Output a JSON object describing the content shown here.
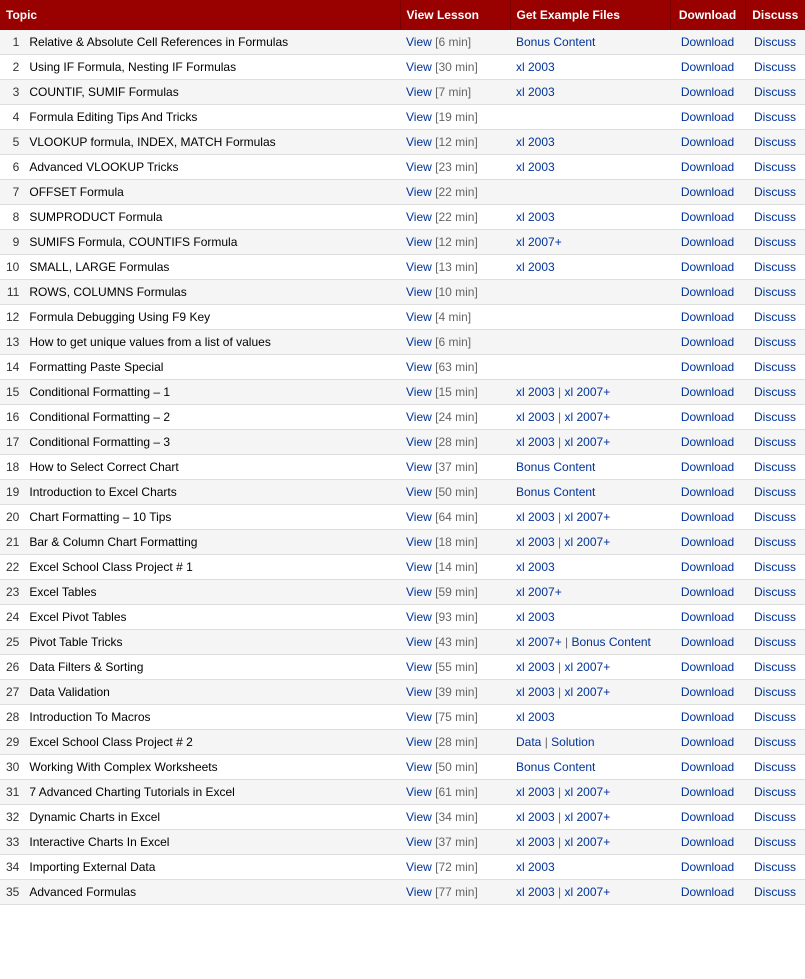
{
  "header": {
    "topic": "Topic",
    "view_lesson": "View Lesson",
    "example_files": "Get Example Files",
    "download": "Download",
    "discuss": "Discuss"
  },
  "rows": [
    {
      "num": 1,
      "topic": "Relative & Absolute Cell References in Formulas",
      "view": "View",
      "duration": "6 min",
      "example": [
        {
          "text": "Bonus Content",
          "href": "#"
        }
      ],
      "download": "Download",
      "discuss": "Discuss"
    },
    {
      "num": 2,
      "topic": "Using IF Formula, Nesting IF Formulas",
      "view": "View",
      "duration": "30 min",
      "example": [
        {
          "text": "xl 2003",
          "href": "#"
        }
      ],
      "download": "Download",
      "discuss": "Discuss"
    },
    {
      "num": 3,
      "topic": "COUNTIF, SUMIF Formulas",
      "view": "View",
      "duration": "7 min",
      "example": [
        {
          "text": "xl 2003",
          "href": "#"
        }
      ],
      "download": "Download",
      "discuss": "Discuss"
    },
    {
      "num": 4,
      "topic": "Formula Editing Tips And Tricks",
      "view": "View",
      "duration": "19 min",
      "example": [],
      "download": "Download",
      "discuss": "Discuss"
    },
    {
      "num": 5,
      "topic": "VLOOKUP formula, INDEX, MATCH Formulas",
      "view": "View",
      "duration": "12 min",
      "example": [
        {
          "text": "xl 2003",
          "href": "#"
        }
      ],
      "download": "Download",
      "discuss": "Discuss"
    },
    {
      "num": 6,
      "topic": "Advanced VLOOKUP Tricks",
      "view": "View",
      "duration": "23 min",
      "example": [
        {
          "text": "xl 2003",
          "href": "#"
        }
      ],
      "download": "Download",
      "discuss": "Discuss"
    },
    {
      "num": 7,
      "topic": "OFFSET Formula",
      "view": "View",
      "duration": "22 min",
      "example": [],
      "download": "Download",
      "discuss": "Discuss"
    },
    {
      "num": 8,
      "topic": "SUMPRODUCT Formula",
      "view": "View",
      "duration": "22 min",
      "example": [
        {
          "text": "xl 2003",
          "href": "#"
        }
      ],
      "download": "Download",
      "discuss": "Discuss"
    },
    {
      "num": 9,
      "topic": "SUMIFS Formula, COUNTIFS Formula",
      "view": "View",
      "duration": "12 min",
      "example": [
        {
          "text": "xl 2007+",
          "href": "#"
        }
      ],
      "download": "Download",
      "discuss": "Discuss"
    },
    {
      "num": 10,
      "topic": "SMALL, LARGE Formulas",
      "view": "View",
      "duration": "13 min",
      "example": [
        {
          "text": "xl 2003",
          "href": "#"
        }
      ],
      "download": "Download",
      "discuss": "Discuss"
    },
    {
      "num": 11,
      "topic": "ROWS, COLUMNS Formulas",
      "view": "View",
      "duration": "10 min",
      "example": [],
      "download": "Download",
      "discuss": "Discuss"
    },
    {
      "num": 12,
      "topic": "Formula Debugging Using F9 Key",
      "view": "View",
      "duration": "4 min",
      "example": [],
      "download": "Download",
      "discuss": "Discuss"
    },
    {
      "num": 13,
      "topic": "How to get unique values from a list of values",
      "view": "View",
      "duration": "6 min",
      "example": [],
      "download": "Download",
      "discuss": "Discuss"
    },
    {
      "num": 14,
      "topic": "Formatting Paste Special",
      "view": "View",
      "duration": "63 min",
      "example": [],
      "download": "Download",
      "discuss": "Discuss"
    },
    {
      "num": 15,
      "topic": "Conditional Formatting – 1",
      "view": "View",
      "duration": "15 min",
      "example": [
        {
          "text": "xl 2003",
          "href": "#"
        },
        {
          "text": "xl 2007+",
          "href": "#"
        }
      ],
      "download": "Download",
      "discuss": "Discuss"
    },
    {
      "num": 16,
      "topic": "Conditional Formatting – 2",
      "view": "View",
      "duration": "24 min",
      "example": [
        {
          "text": "xl 2003",
          "href": "#"
        },
        {
          "text": "xl 2007+",
          "href": "#"
        }
      ],
      "download": "Download",
      "discuss": "Discuss"
    },
    {
      "num": 17,
      "topic": "Conditional Formatting – 3",
      "view": "View",
      "duration": "28 min",
      "example": [
        {
          "text": "xl 2003",
          "href": "#"
        },
        {
          "text": "xl 2007+",
          "href": "#"
        }
      ],
      "download": "Download",
      "discuss": "Discuss"
    },
    {
      "num": 18,
      "topic": "How to Select Correct Chart",
      "view": "View",
      "duration": "37 min",
      "example": [
        {
          "text": "Bonus Content",
          "href": "#"
        }
      ],
      "download": "Download",
      "discuss": "Discuss"
    },
    {
      "num": 19,
      "topic": "Introduction to Excel Charts",
      "view": "View",
      "duration": "50 min",
      "example": [
        {
          "text": "Bonus Content",
          "href": "#"
        }
      ],
      "download": "Download",
      "discuss": "Discuss"
    },
    {
      "num": 20,
      "topic": "Chart Formatting – 10 Tips",
      "view": "View",
      "duration": "64 min",
      "example": [
        {
          "text": "xl 2003",
          "href": "#"
        },
        {
          "text": "xl 2007+",
          "href": "#"
        }
      ],
      "download": "Download",
      "discuss": "Discuss"
    },
    {
      "num": 21,
      "topic": "Bar & Column Chart Formatting",
      "view": "View",
      "duration": "18 min",
      "example": [
        {
          "text": "xl 2003",
          "href": "#"
        },
        {
          "text": "xl 2007+",
          "href": "#"
        }
      ],
      "download": "Download",
      "discuss": "Discuss"
    },
    {
      "num": 22,
      "topic": "Excel School Class Project # 1",
      "view": "View",
      "duration": "14 min",
      "example": [
        {
          "text": "xl 2003",
          "href": "#"
        }
      ],
      "download": "Download",
      "discuss": "Discuss"
    },
    {
      "num": 23,
      "topic": "Excel Tables",
      "view": "View",
      "duration": "59 min",
      "example": [
        {
          "text": "xl 2007+",
          "href": "#"
        }
      ],
      "download": "Download",
      "discuss": "Discuss"
    },
    {
      "num": 24,
      "topic": "Excel Pivot Tables",
      "view": "View",
      "duration": "93 min",
      "example": [
        {
          "text": "xl 2003",
          "href": "#"
        }
      ],
      "download": "Download",
      "discuss": "Discuss"
    },
    {
      "num": 25,
      "topic": "Pivot Table Tricks",
      "view": "View",
      "duration": "43 min",
      "example": [
        {
          "text": "xl 2007+",
          "href": "#"
        },
        {
          "text": "Bonus Content",
          "href": "#"
        }
      ],
      "download": "Download",
      "discuss": "Discuss"
    },
    {
      "num": 26,
      "topic": "Data Filters & Sorting",
      "view": "View",
      "duration": "55 min",
      "example": [
        {
          "text": "xl 2003",
          "href": "#"
        },
        {
          "text": "xl 2007+",
          "href": "#"
        }
      ],
      "download": "Download",
      "discuss": "Discuss"
    },
    {
      "num": 27,
      "topic": "Data Validation",
      "view": "View",
      "duration": "39 min",
      "example": [
        {
          "text": "xl 2003",
          "href": "#"
        },
        {
          "text": "xl 2007+",
          "href": "#"
        }
      ],
      "download": "Download",
      "discuss": "Discuss"
    },
    {
      "num": 28,
      "topic": "Introduction To Macros",
      "view": "View",
      "duration": "75 min",
      "example": [
        {
          "text": "xl 2003",
          "href": "#"
        }
      ],
      "download": "Download",
      "discuss": "Discuss"
    },
    {
      "num": 29,
      "topic": "Excel School Class Project # 2",
      "view": "View",
      "duration": "28 min",
      "example": [
        {
          "text": "Data",
          "href": "#"
        },
        {
          "text": "Solution",
          "href": "#"
        }
      ],
      "download": "Download",
      "discuss": "Discuss"
    },
    {
      "num": 30,
      "topic": "Working With Complex Worksheets",
      "view": "View",
      "duration": "50 min",
      "example": [
        {
          "text": "Bonus Content",
          "href": "#"
        }
      ],
      "download": "Download",
      "discuss": "Discuss"
    },
    {
      "num": 31,
      "topic": "7 Advanced Charting Tutorials in Excel",
      "view": "View",
      "duration": "61 min",
      "example": [
        {
          "text": "xl 2003",
          "href": "#"
        },
        {
          "text": "xl 2007+",
          "href": "#"
        }
      ],
      "download": "Download",
      "discuss": "Discuss"
    },
    {
      "num": 32,
      "topic": "Dynamic Charts in Excel",
      "view": "View",
      "duration": "34 min",
      "example": [
        {
          "text": "xl 2003",
          "href": "#"
        },
        {
          "text": "xl 2007+",
          "href": "#"
        }
      ],
      "download": "Download",
      "discuss": "Discuss"
    },
    {
      "num": 33,
      "topic": "Interactive Charts In Excel",
      "view": "View",
      "duration": "37 min",
      "example": [
        {
          "text": "xl 2003",
          "href": "#"
        },
        {
          "text": "xl 2007+",
          "href": "#"
        }
      ],
      "download": "Download",
      "discuss": "Discuss"
    },
    {
      "num": 34,
      "topic": "Importing External Data",
      "view": "View",
      "duration": "72 min",
      "example": [
        {
          "text": "xl 2003",
          "href": "#"
        }
      ],
      "download": "Download",
      "discuss": "Discuss"
    },
    {
      "num": 35,
      "topic": "Advanced Formulas",
      "view": "View",
      "duration": "77 min",
      "example": [
        {
          "text": "xl 2003",
          "href": "#"
        },
        {
          "text": "xl 2007+",
          "href": "#"
        }
      ],
      "download": "Download",
      "discuss": "Discuss"
    }
  ]
}
